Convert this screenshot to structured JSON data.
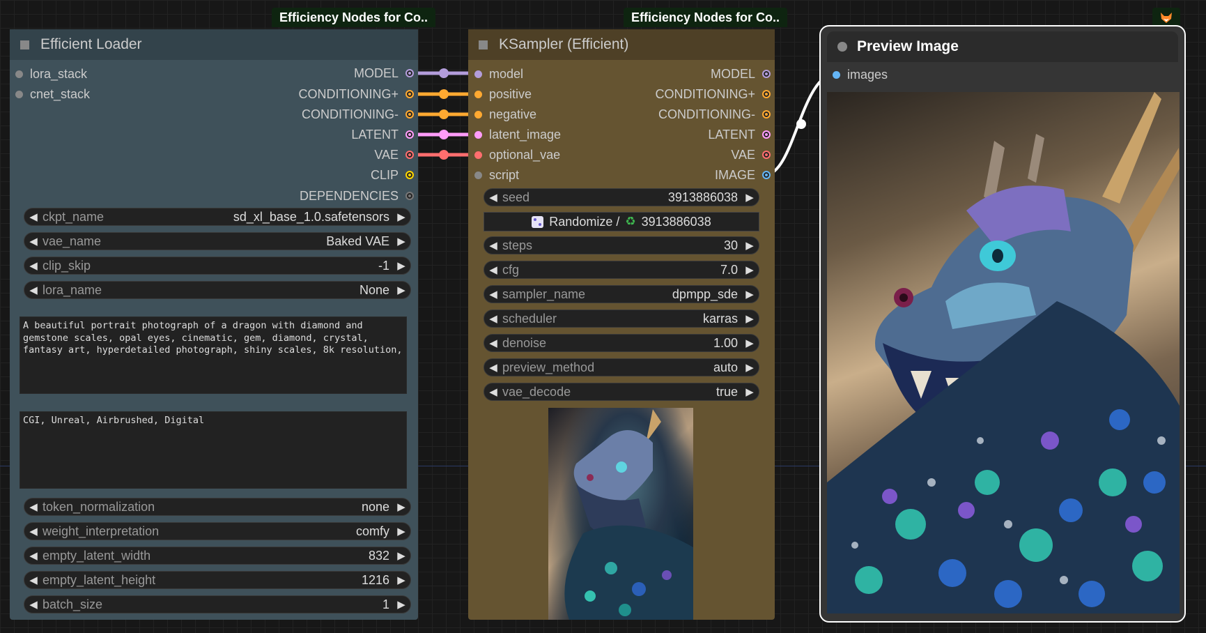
{
  "badges": {
    "loader": "Efficiency Nodes for Co..",
    "ksampler": "Efficiency Nodes for Co.."
  },
  "loader": {
    "title": "Efficient Loader",
    "inputs": [
      "lora_stack",
      "cnet_stack"
    ],
    "outputs": [
      "MODEL",
      "CONDITIONING+",
      "CONDITIONING-",
      "LATENT",
      "VAE",
      "CLIP",
      "DEPENDENCIES"
    ],
    "widgets_top": [
      {
        "label": "ckpt_name",
        "value": "sd_xl_base_1.0.safetensors"
      },
      {
        "label": "vae_name",
        "value": "Baked VAE"
      },
      {
        "label": "clip_skip",
        "value": "-1"
      },
      {
        "label": "lora_name",
        "value": "None"
      }
    ],
    "positive_prompt": "A beautiful portrait photograph of a dragon with diamond and\ngemstone scales, opal eyes, cinematic, gem, diamond, crystal,\nfantasy art, hyperdetailed photograph, shiny scales, 8k resolution,",
    "negative_prompt": "CGI, Unreal, Airbrushed, Digital",
    "widgets_bottom": [
      {
        "label": "token_normalization",
        "value": "none"
      },
      {
        "label": "weight_interpretation",
        "value": "comfy"
      },
      {
        "label": "empty_latent_width",
        "value": "832"
      },
      {
        "label": "empty_latent_height",
        "value": "1216"
      },
      {
        "label": "batch_size",
        "value": "1"
      }
    ]
  },
  "ksampler": {
    "title": "KSampler (Efficient)",
    "inputs": [
      "model",
      "positive",
      "negative",
      "latent_image",
      "optional_vae",
      "script"
    ],
    "outputs": [
      "MODEL",
      "CONDITIONING+",
      "CONDITIONING-",
      "LATENT",
      "VAE",
      "IMAGE"
    ],
    "seed": {
      "label": "seed",
      "value": "3913886038"
    },
    "randomize": {
      "label": "Randomize /",
      "value": "3913886038"
    },
    "widgets": [
      {
        "label": "steps",
        "value": "30"
      },
      {
        "label": "cfg",
        "value": "7.0"
      },
      {
        "label": "sampler_name",
        "value": "dpmpp_sde"
      },
      {
        "label": "scheduler",
        "value": "karras"
      },
      {
        "label": "denoise",
        "value": "1.00"
      },
      {
        "label": "preview_method",
        "value": "auto"
      },
      {
        "label": "vae_decode",
        "value": "true"
      }
    ]
  },
  "preview": {
    "title": "Preview Image",
    "inputs": [
      "images"
    ]
  },
  "colors": {
    "model": "#b39ddb",
    "conditioning": "#ffa931",
    "latent": "#ff9cf9",
    "vae": "#ff6e6e",
    "clip": "#ffd500",
    "image": "#64b5f6",
    "other": "#888888"
  },
  "icons": {
    "randomize": "dice-icon",
    "recycle": "recycle-icon",
    "preview_badge": "fox-icon"
  }
}
